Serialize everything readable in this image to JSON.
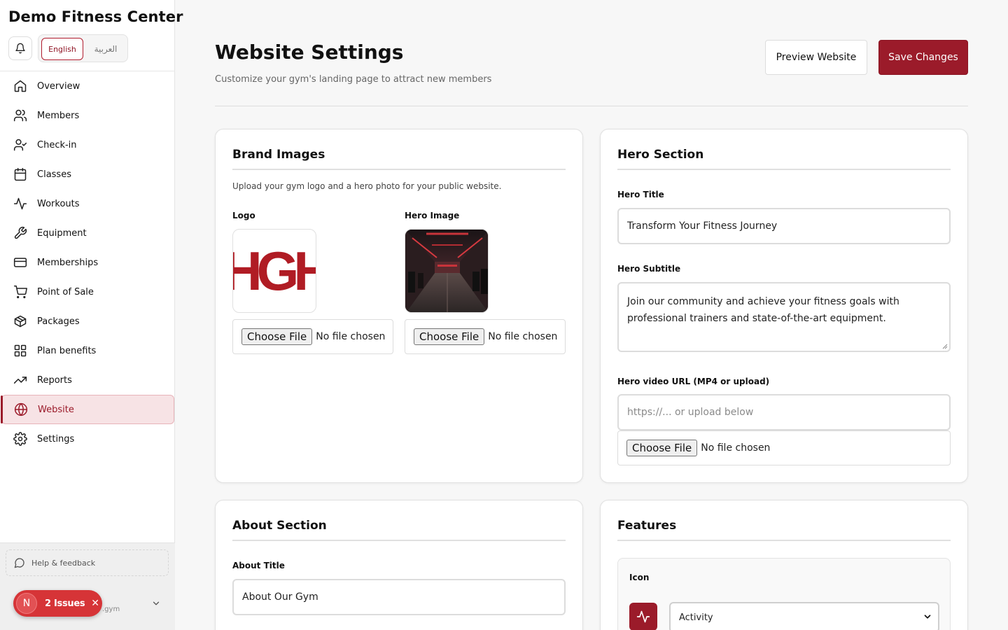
{
  "sidebar": {
    "brand": "Demo Fitness Center",
    "lang_en": "English",
    "lang_ar": "العربية",
    "items": [
      {
        "label": "Overview",
        "icon": "home-icon"
      },
      {
        "label": "Members",
        "icon": "users-icon"
      },
      {
        "label": "Check-in",
        "icon": "user-check-icon"
      },
      {
        "label": "Classes",
        "icon": "calendar-icon"
      },
      {
        "label": "Workouts",
        "icon": "activity-icon"
      },
      {
        "label": "Equipment",
        "icon": "wrench-icon"
      },
      {
        "label": "Memberships",
        "icon": "credit-card-icon"
      },
      {
        "label": "Point of Sale",
        "icon": "cart-icon"
      },
      {
        "label": "Packages",
        "icon": "package-icon"
      },
      {
        "label": "Plan benefits",
        "icon": "grid-icon"
      },
      {
        "label": "Reports",
        "icon": "trending-up-icon"
      },
      {
        "label": "Website",
        "icon": "globe-icon",
        "active": true
      },
      {
        "label": "Settings",
        "icon": "gear-icon"
      }
    ],
    "help": "Help & feedback",
    "user_suffix": ".gym"
  },
  "issues": {
    "avatar": "N",
    "label": "2 Issues"
  },
  "header": {
    "title": "Website Settings",
    "subtitle": "Customize your gym's landing page to attract new members",
    "preview_label": "Preview Website",
    "save_label": "Save Changes"
  },
  "brand_images": {
    "title": "Brand Images",
    "description": "Upload your gym logo and a hero photo for your public website.",
    "logo_label": "Logo",
    "logo_text": "HGH",
    "hero_label": "Hero Image",
    "choose_file": "Choose File",
    "no_file": "No file chosen"
  },
  "hero_section": {
    "title": "Hero Section",
    "hero_title_label": "Hero Title",
    "hero_title_value": "Transform Your Fitness Journey",
    "hero_subtitle_label": "Hero Subtitle",
    "hero_subtitle_value": "Join our community and achieve your fitness goals with professional trainers and state-of-the-art equipment.",
    "video_label": "Hero video URL (MP4 or upload)",
    "video_placeholder": "https://... or upload below",
    "choose_file": "Choose File",
    "no_file": "No file chosen"
  },
  "about_section": {
    "title": "About Section",
    "about_title_label": "About Title",
    "about_title_value": "About Our Gym"
  },
  "features": {
    "title": "Features",
    "icon_label": "Icon",
    "icon_value": "Activity"
  },
  "colors": {
    "accent": "#9b1b2a",
    "accent_light": "#f7e3e5",
    "issues": "#d63437"
  }
}
